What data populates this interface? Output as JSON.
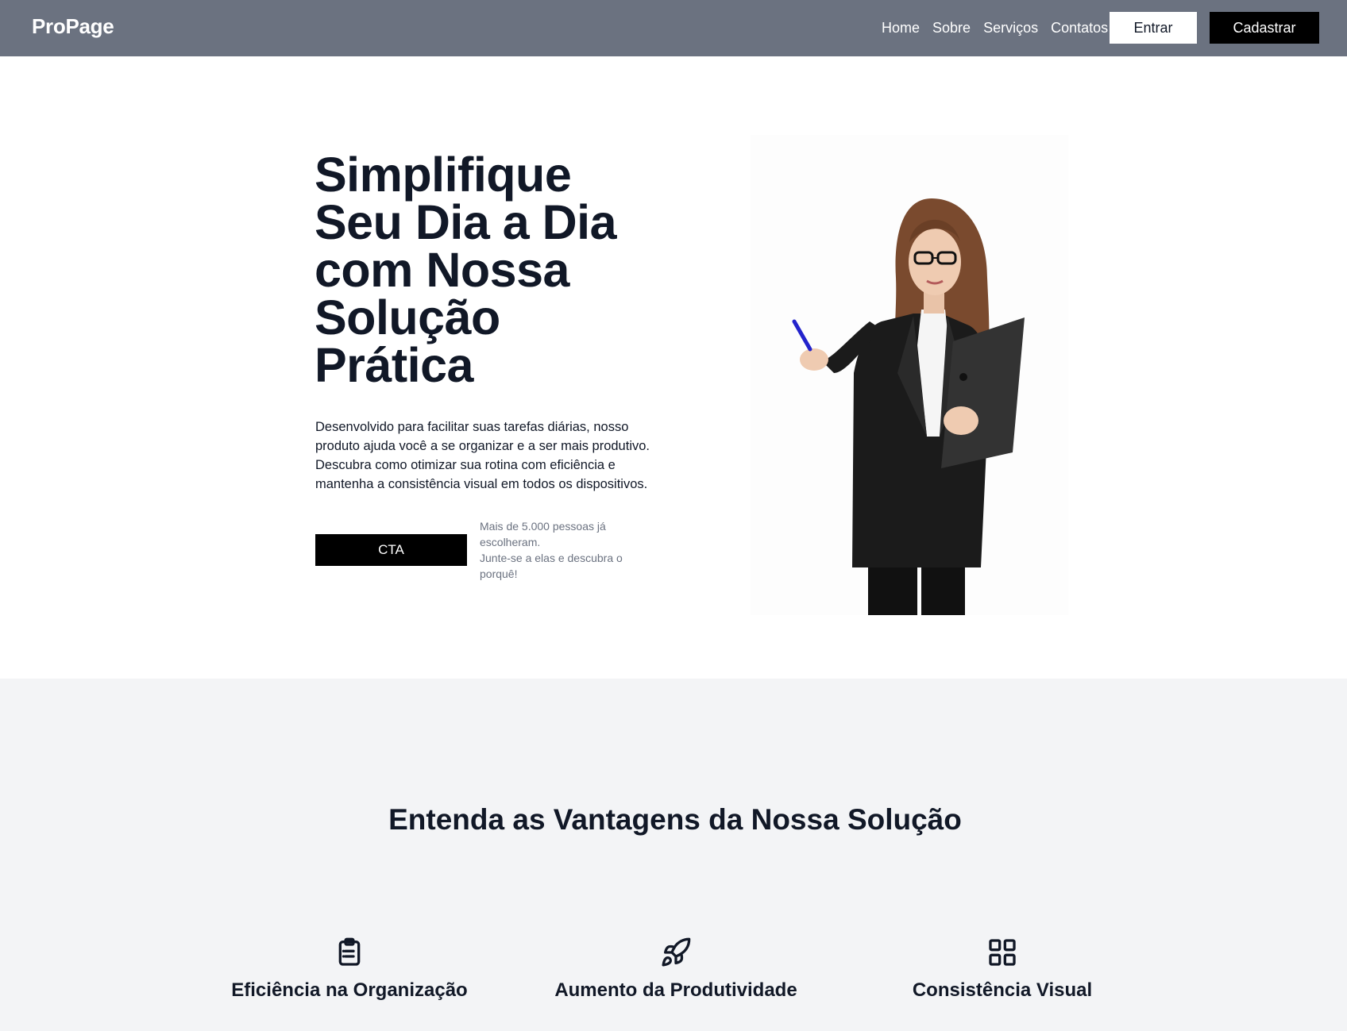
{
  "header": {
    "logo": "ProPage",
    "nav": [
      "Home",
      "Sobre",
      "Serviços",
      "Contatos"
    ],
    "login_label": "Entrar",
    "signup_label": "Cadastrar"
  },
  "hero": {
    "title": "Simplifique Seu Dia a Dia com Nossa Solução Prática",
    "description": "Desenvolvido para facilitar suas tarefas diárias, nosso produto ajuda você a se organizar e a ser mais produtivo. Descubra como otimizar sua rotina com eficiência e mantenha a consistência visual em todos os dispositivos.",
    "cta_label": "CTA",
    "social_proof_line1": "Mais de 5.000 pessoas já escolheram.",
    "social_proof_line2": "Junte-se a elas e descubra o porquê!"
  },
  "features": {
    "title": "Entenda as Vantagens da Nossa Solução",
    "items": [
      {
        "icon": "clipboard-list-icon",
        "title": "Eficiência na Organização"
      },
      {
        "icon": "rocket-icon",
        "title": "Aumento da Produtividade"
      },
      {
        "icon": "grid-icon",
        "title": "Consistência Visual"
      }
    ]
  },
  "colors": {
    "header_bg": "#6b7280",
    "primary": "#000000",
    "text": "#111827",
    "muted": "#6b7280",
    "section_bg": "#f3f4f6"
  }
}
